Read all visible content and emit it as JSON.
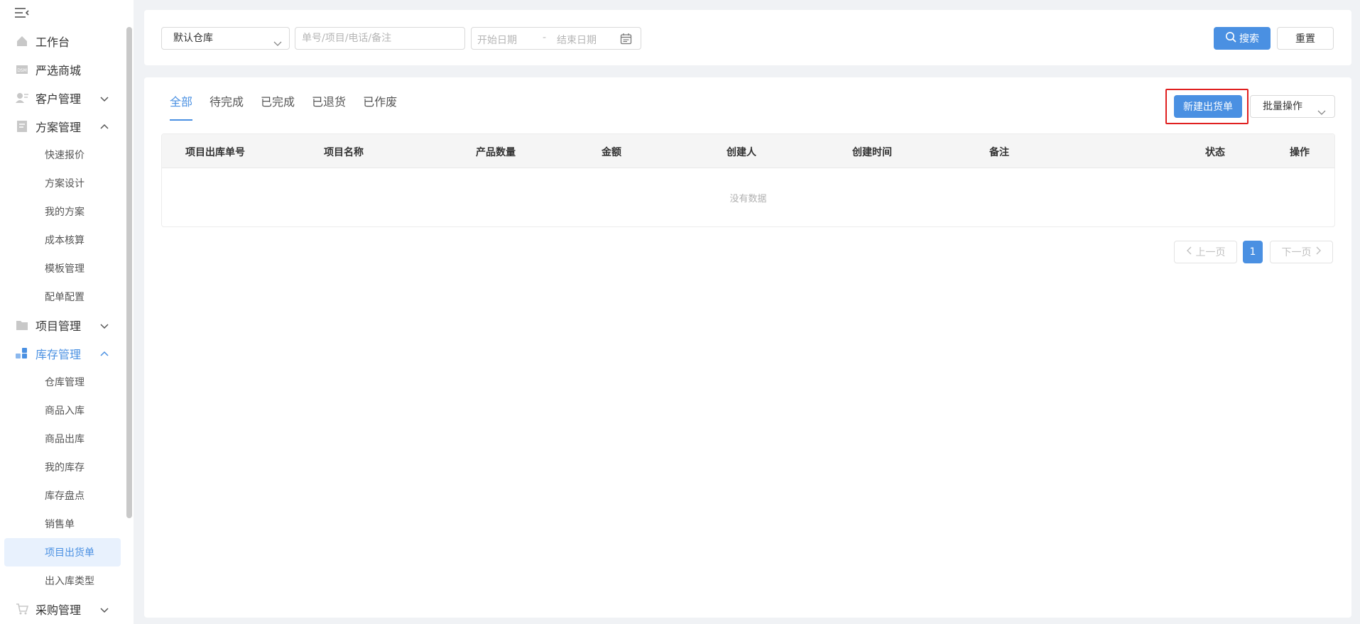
{
  "sidebar": {
    "menu": [
      {
        "label": "工作台",
        "icon": "home-icon"
      },
      {
        "label": "严选商城",
        "icon": "store-icon"
      },
      {
        "label": "客户管理",
        "icon": "customer-icon"
      },
      {
        "label": "方案管理",
        "icon": "document-icon"
      },
      {
        "label": "项目管理",
        "icon": "folder-icon"
      },
      {
        "label": "库存管理",
        "icon": "inventory-icon"
      },
      {
        "label": "采购管理",
        "icon": "cart-icon"
      }
    ],
    "plan_sub": [
      "快速报价",
      "方案设计",
      "我的方案",
      "成本核算",
      "模板管理",
      "配单配置"
    ],
    "stock_sub": [
      "仓库管理",
      "商品入库",
      "商品出库",
      "我的库存",
      "库存盘点",
      "销售单",
      "项目出货单",
      "出入库类型"
    ],
    "selected_sub": "项目出货单"
  },
  "filter": {
    "warehouse": "默认仓库",
    "search_placeholder": "单号/项目/电话/备注",
    "date_start_placeholder": "开始日期",
    "date_sep": "-",
    "date_end_placeholder": "结束日期",
    "search_label": "搜索",
    "reset_label": "重置"
  },
  "tabs": [
    "全部",
    "待完成",
    "已完成",
    "已退货",
    "已作废"
  ],
  "actions": {
    "new_label": "新建出货单",
    "batch_label": "批量操作"
  },
  "table": {
    "columns": [
      "项目出库单号",
      "项目名称",
      "产品数量",
      "金额",
      "创建人",
      "创建时间",
      "备注",
      "状态",
      "操作"
    ],
    "empty_text": "没有数据"
  },
  "pagination": {
    "prev": "上一页",
    "current": "1",
    "next": "下一页"
  },
  "colors": {
    "accent": "#4a90e2",
    "highlight": "#e02020"
  }
}
